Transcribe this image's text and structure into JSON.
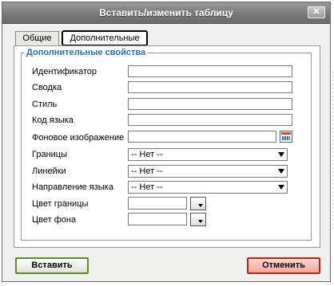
{
  "dialog": {
    "title": "Вставить/изменить таблицу",
    "close_label": "✕"
  },
  "tabs": [
    {
      "label": "Общие",
      "active": false
    },
    {
      "label": "Дополнительные",
      "active": true
    }
  ],
  "section": {
    "legend": "Дополнительные свойства"
  },
  "fields": {
    "id": {
      "label": "Идентификатор",
      "value": ""
    },
    "summary": {
      "label": "Сводка",
      "value": ""
    },
    "style": {
      "label": "Стиль",
      "value": ""
    },
    "lang": {
      "label": "Код языка",
      "value": ""
    },
    "bg_image": {
      "label": "Фоновое изображение",
      "value": ""
    },
    "frame": {
      "label": "Границы",
      "selected": "-- Нет --"
    },
    "rules": {
      "label": "Линейки",
      "selected": "-- Нет --"
    },
    "dir": {
      "label": "Направление языка",
      "selected": "-- Нет --"
    },
    "border_color": {
      "label": "Цвет границы",
      "value": ""
    },
    "bg_color": {
      "label": "Цвет фона",
      "value": ""
    }
  },
  "buttons": {
    "insert": "Вставить",
    "cancel": "Отменить"
  },
  "colors": {
    "legend": "#2b6fb6",
    "insert_border": "#5e8a2a",
    "cancel_border": "#b5251d"
  }
}
